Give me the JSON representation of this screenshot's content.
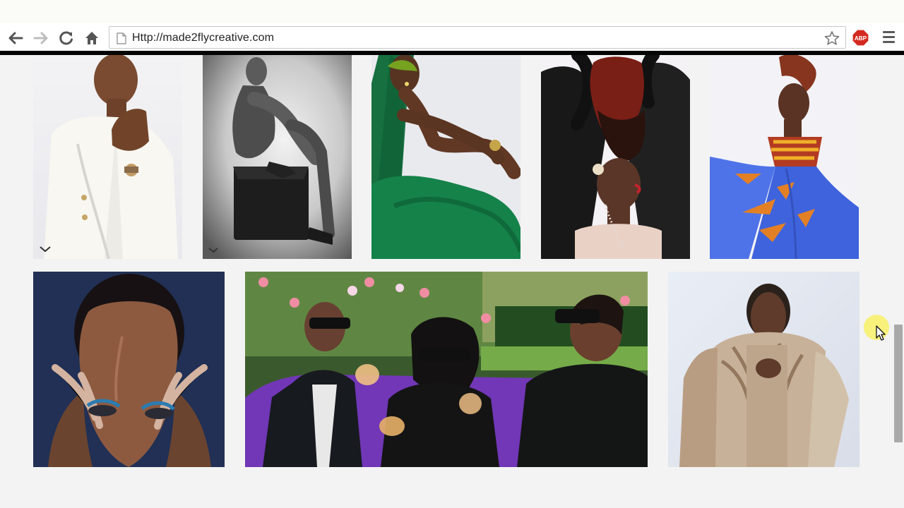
{
  "browser": {
    "url": "Http://made2flycreative.com",
    "icons": {
      "back": "back-arrow-icon",
      "forward": "forward-arrow-icon",
      "reload": "reload-icon",
      "home": "home-icon",
      "page": "page-icon",
      "bookmark": "star-icon",
      "adblock": "abp-icon",
      "menu": "hamburger-menu-icon"
    },
    "adblock_label": "ABP",
    "colors": {
      "adblock": "#d32a1f",
      "toolbar_divider": "#050505"
    }
  },
  "gallery": {
    "row1": [
      {
        "subject": "bald woman in white blazer holding cigarette"
      },
      {
        "subject": "black and white portrait seated on ottoman"
      },
      {
        "subject": "woman with green fabric and gold accessories"
      },
      {
        "subject": "woman with red locs and sheer black sleeves"
      },
      {
        "subject": "woman in blue tulle dress"
      }
    ],
    "row2": [
      {
        "subject": "beauty close-up with blue eyeshadow"
      },
      {
        "subject": "group laughing with drinks in garden"
      },
      {
        "subject": "woman in fur coat"
      }
    ]
  },
  "scrollbar": {
    "position": "middle"
  }
}
